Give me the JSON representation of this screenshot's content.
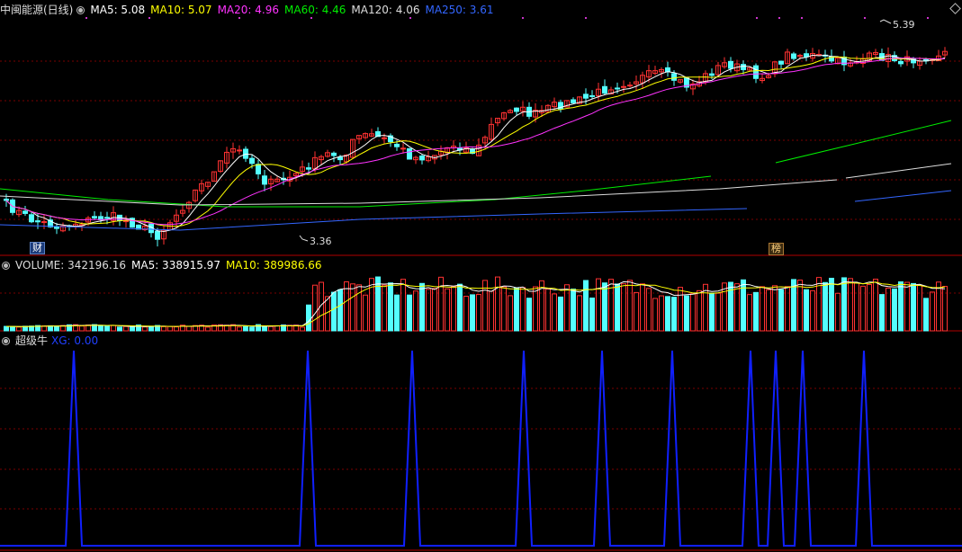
{
  "price_panel": {
    "stock_name": "中闽能源(日线)",
    "indicators": [
      {
        "label": "MA5: 5.08",
        "color": "#ffffff"
      },
      {
        "label": "MA10: 5.07",
        "color": "#ffff00"
      },
      {
        "label": "MA20: 4.96",
        "color": "#ff33ff"
      },
      {
        "label": "MA60: 4.46",
        "color": "#00ee00"
      },
      {
        "label": "MA120: 4.06",
        "color": "#dddddd"
      },
      {
        "label": "MA250: 3.61",
        "color": "#3366ff"
      }
    ],
    "high_label": "5.39",
    "low_label": "3.36",
    "tag_left": "财",
    "tag_right": "榜",
    "diamond_icon": "diamond-icon"
  },
  "volume_panel": {
    "label": "VOLUME: 342196.16",
    "ma5": "MA5: 338915.97",
    "ma10": "MA10: 389986.66"
  },
  "indicator_panel": {
    "name": "超级牛",
    "value_label": "XG: 0.00"
  },
  "colors": {
    "up": "#ff3232",
    "down": "#54ffff",
    "grid": "#7a0000",
    "border": "#b00000",
    "signal": "#1020ff"
  },
  "chart_data": [
    {
      "type": "candlestick",
      "title": "中闽能源(日线)",
      "series": [
        {
          "name": "MA5",
          "value": 5.08
        },
        {
          "name": "MA10",
          "value": 5.07
        },
        {
          "name": "MA20",
          "value": 4.96
        },
        {
          "name": "MA60",
          "value": 4.46
        },
        {
          "name": "MA120",
          "value": 4.06
        },
        {
          "name": "MA250",
          "value": 3.61
        }
      ],
      "annotations": [
        "5.39",
        "3.36"
      ]
    },
    {
      "type": "bar",
      "title": "VOLUME",
      "series": [
        {
          "name": "VOLUME",
          "value": 342196.16
        },
        {
          "name": "MA5",
          "value": 338915.97
        },
        {
          "name": "MA10",
          "value": 389986.66
        }
      ]
    },
    {
      "type": "line",
      "title": "超级牛",
      "series": [
        {
          "name": "XG",
          "value": 0.0
        }
      ]
    }
  ]
}
